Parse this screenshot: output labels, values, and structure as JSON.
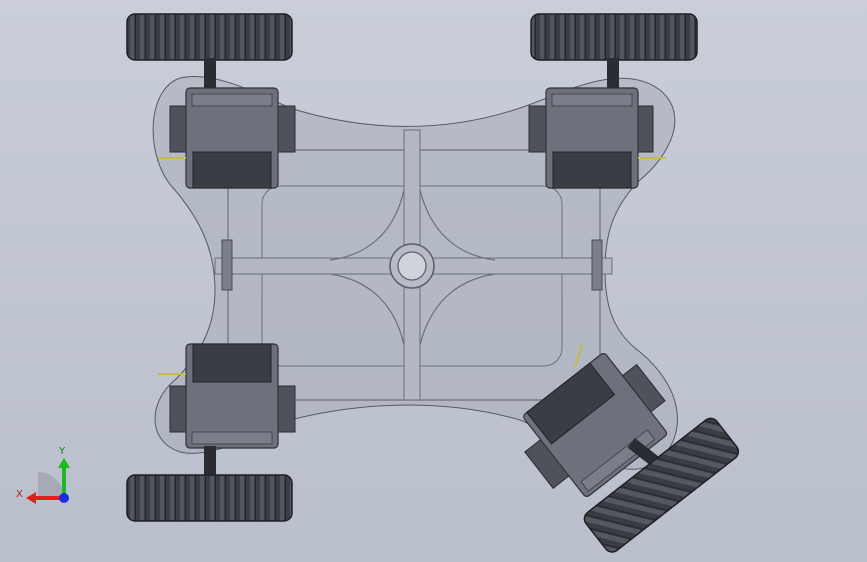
{
  "viewport": {
    "kind": "3D CAD model view",
    "background_color": "#bfc4ce",
    "model": {
      "wheels": [
        "front-left",
        "front-right",
        "rear-left",
        "rear-right"
      ],
      "servos": [
        "front-left",
        "front-right",
        "rear-left",
        "rear-right"
      ],
      "rear_right_wheel_state": "rotated",
      "chassis_color": "#9aa0ad",
      "servo_color": "#5c5f6a",
      "wheel_color": "#3a3c44"
    }
  },
  "triad": {
    "x_label": "X",
    "y_label": "Y",
    "x_color": "#e0201a",
    "y_color": "#1fb81f",
    "z_color": "#1a2ee0"
  }
}
